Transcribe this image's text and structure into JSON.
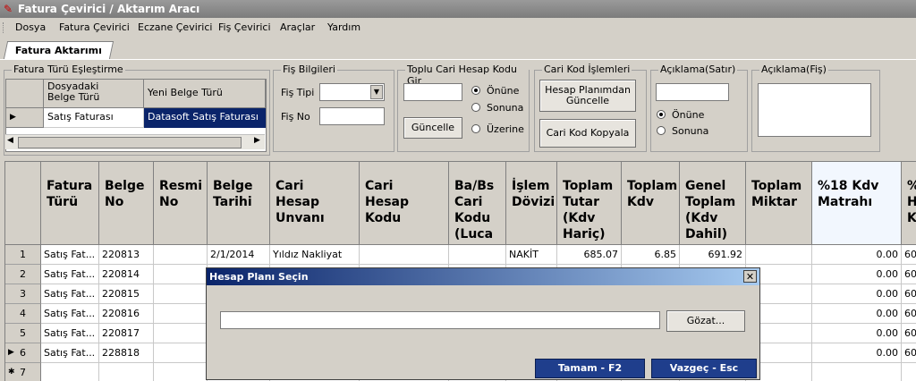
{
  "window": {
    "title": "Fatura Çevirici / Aktarım Aracı"
  },
  "menu": [
    "Dosya",
    "Fatura Çevirici",
    "Eczane Çevirici",
    "Fiş Çevirici",
    "Araçlar",
    "Yardım"
  ],
  "tab": {
    "label": "Fatura Aktarımı"
  },
  "fatura_turu": {
    "legend": "Fatura Türü Eşleştirme",
    "col1": "Dosyadaki\nBelge Türü",
    "col2": "Yeni Belge Türü",
    "row_source": "Satış Faturası",
    "row_target": "Datasoft Satış Faturası"
  },
  "fis_bilgileri": {
    "legend": "Fiş Bilgileri",
    "fis_tipi_label": "Fiş Tipi",
    "fis_no_label": "Fiş No",
    "fis_tipi_value": "",
    "fis_no_value": ""
  },
  "toplu_cari": {
    "legend": "Toplu Cari Hesap Kodu Gir",
    "option1": "Önüne",
    "option2": "Sonuna",
    "option3": "Üzerine",
    "button": "Güncelle",
    "selected": "Önüne"
  },
  "cari_kod": {
    "legend": "Cari Kod İşlemleri",
    "button1": "Hesap Planımdan Güncelle",
    "button2": "Cari Kod Kopyala"
  },
  "aciklama_satir": {
    "legend": "Açıklama(Satır)",
    "option1": "Önüne",
    "option2": "Sonuna",
    "selected": "Önüne"
  },
  "aciklama_fis": {
    "legend": "Açıklama(Fiş)"
  },
  "grid": {
    "columns": [
      "Fatura\nTürü",
      "Belge\nNo",
      "Resmi\nNo",
      "Belge\nTarihi",
      "Cari\nHesap\nUnvanı",
      "Cari\nHesap\nKodu",
      "Ba/Bs\nCari\nKodu\n(Luca\niçin)",
      "İşlem\nDövizi",
      "Toplam\nTutar\n(Kdv\nHariç)",
      "Toplam\nKdv",
      "Genel\nToplam\n(Kdv\nDahil)",
      "Toplam\nMiktar",
      "%18 Kdv\nMatrahı",
      "%\nH\nK"
    ],
    "rows": [
      {
        "n": "1",
        "marker": "",
        "fatura": "Satış Fat...",
        "belge": "220813",
        "resmi": "",
        "tarih": "2/1/2014",
        "unvan": "Yıldız Nakliyat",
        "kod": "",
        "babs": "",
        "doviz": "NAKİT",
        "tutar": "685.07",
        "kdv": "6.85",
        "genel": "691.92",
        "miktar": "",
        "matrah": "0.00",
        "last": "60"
      },
      {
        "n": "2",
        "marker": "",
        "fatura": "Satış Fat...",
        "belge": "220814",
        "resmi": "",
        "tarih": "",
        "unvan": "",
        "kod": "",
        "babs": "",
        "doviz": "",
        "tutar": "",
        "kdv": "",
        "genel": "",
        "miktar": "",
        "matrah": "0.00",
        "last": "60"
      },
      {
        "n": "3",
        "marker": "",
        "fatura": "Satış Fat...",
        "belge": "220815",
        "resmi": "",
        "tarih": "",
        "unvan": "",
        "kod": "",
        "babs": "",
        "doviz": "",
        "tutar": "",
        "kdv": "",
        "genel": "",
        "miktar": "",
        "matrah": "0.00",
        "last": "60"
      },
      {
        "n": "4",
        "marker": "",
        "fatura": "Satış Fat...",
        "belge": "220816",
        "resmi": "",
        "tarih": "",
        "unvan": "",
        "kod": "",
        "babs": "",
        "doviz": "",
        "tutar": "",
        "kdv": "",
        "genel": "",
        "miktar": "",
        "matrah": "0.00",
        "last": "60"
      },
      {
        "n": "5",
        "marker": "",
        "fatura": "Satış Fat...",
        "belge": "220817",
        "resmi": "",
        "tarih": "",
        "unvan": "",
        "kod": "",
        "babs": "",
        "doviz": "",
        "tutar": "",
        "kdv": "",
        "genel": "",
        "miktar": "",
        "matrah": "0.00",
        "last": "60"
      },
      {
        "n": "6",
        "marker": "▶",
        "fatura": "Satış Fat...",
        "belge": "228818",
        "resmi": "",
        "tarih": "",
        "unvan": "",
        "kod": "",
        "babs": "",
        "doviz": "",
        "tutar": "",
        "kdv": "",
        "genel": "",
        "miktar": "",
        "matrah": "0.00",
        "last": "60"
      },
      {
        "n": "7",
        "marker": "✱",
        "fatura": "",
        "belge": "",
        "resmi": "",
        "tarih": "",
        "unvan": "",
        "kod": "",
        "babs": "",
        "doviz": "",
        "tutar": "",
        "kdv": "",
        "genel": "",
        "miktar": "",
        "matrah": "",
        "last": ""
      }
    ]
  },
  "dialog": {
    "title": "Hesap Planı Seçin",
    "path_value": "",
    "browse": "Gözat...",
    "ok": "Tamam - F2",
    "cancel": "Vazgeç - Esc"
  }
}
